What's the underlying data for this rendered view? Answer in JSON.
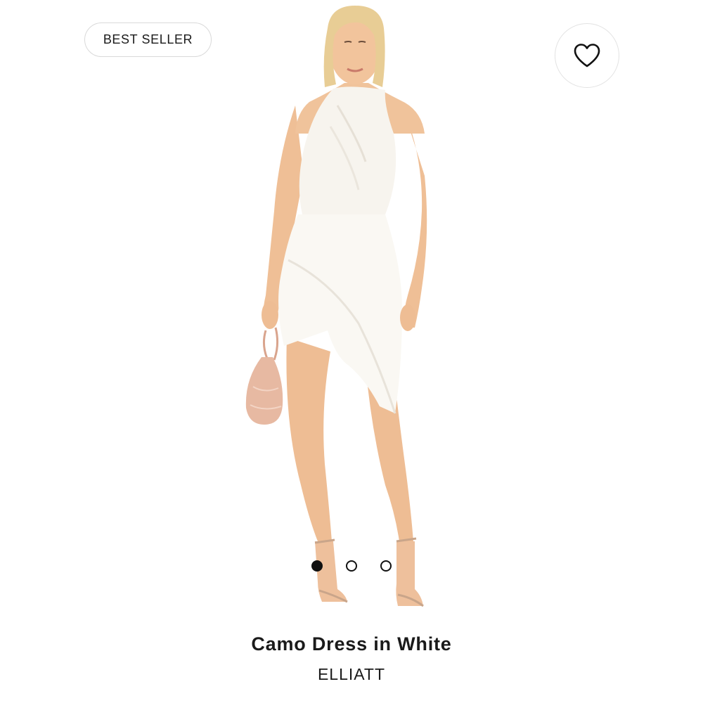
{
  "badge": {
    "label": "BEST SELLER"
  },
  "favorite": {
    "icon": "heart-outline-icon"
  },
  "carousel": {
    "count": 3,
    "active_index": 0
  },
  "product": {
    "title": "Camo Dress in White",
    "brand": "ELLIATT"
  },
  "colors": {
    "text": "#1a1a1a",
    "badge_border": "#d9d9d9",
    "dress": "#faf8f3",
    "skin": "#f2c49c",
    "hair": "#e8cd95",
    "bag": "#e7b9a2"
  }
}
